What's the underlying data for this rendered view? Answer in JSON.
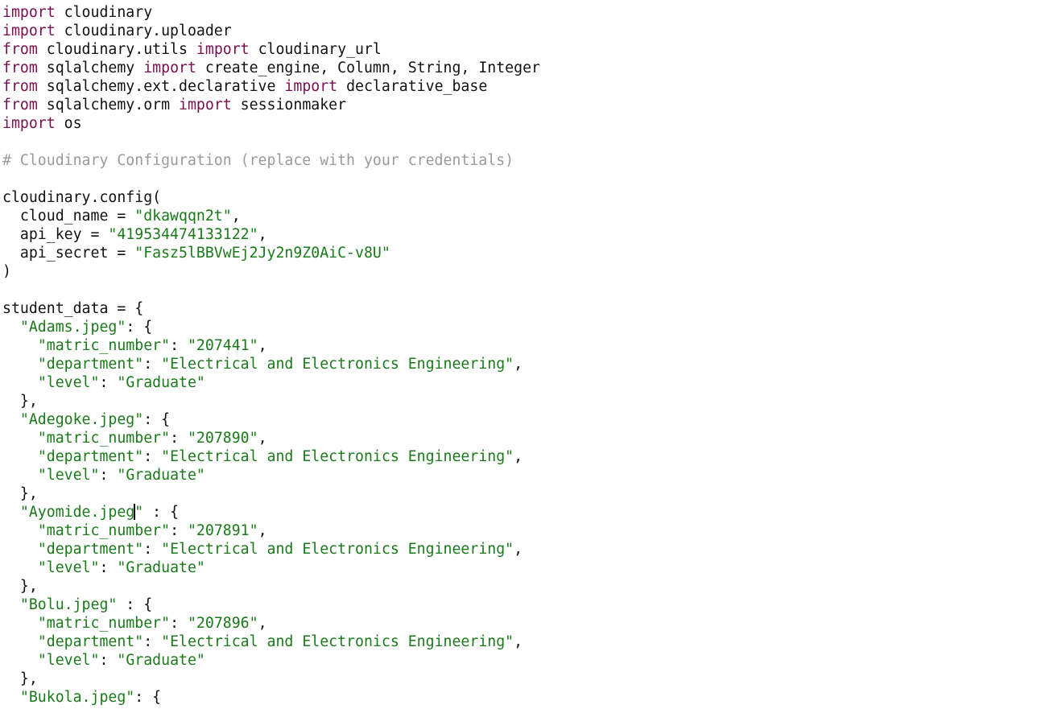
{
  "editor": {
    "cursor_line_index": 27,
    "colors": {
      "keyword": "#7a0f4f",
      "string": "#1a7a1a",
      "comment": "#9a9a9a",
      "text": "#111111",
      "background": "#ffffff"
    },
    "lines": [
      [
        {
          "t": "kw",
          "v": "import"
        },
        {
          "t": "plain",
          "v": " cloudinary"
        }
      ],
      [
        {
          "t": "kw",
          "v": "import"
        },
        {
          "t": "plain",
          "v": " cloudinary.uploader"
        }
      ],
      [
        {
          "t": "kw",
          "v": "from"
        },
        {
          "t": "plain",
          "v": " cloudinary.utils "
        },
        {
          "t": "kw",
          "v": "import"
        },
        {
          "t": "plain",
          "v": " cloudinary_url"
        }
      ],
      [
        {
          "t": "kw",
          "v": "from"
        },
        {
          "t": "plain",
          "v": " sqlalchemy "
        },
        {
          "t": "kw",
          "v": "import"
        },
        {
          "t": "plain",
          "v": " create_engine, Column, String, Integer"
        }
      ],
      [
        {
          "t": "kw",
          "v": "from"
        },
        {
          "t": "plain",
          "v": " sqlalchemy.ext.declarative "
        },
        {
          "t": "kw",
          "v": "import"
        },
        {
          "t": "plain",
          "v": " declarative_base"
        }
      ],
      [
        {
          "t": "kw",
          "v": "from"
        },
        {
          "t": "plain",
          "v": " sqlalchemy.orm "
        },
        {
          "t": "kw",
          "v": "import"
        },
        {
          "t": "plain",
          "v": " sessionmaker"
        }
      ],
      [
        {
          "t": "kw",
          "v": "import"
        },
        {
          "t": "plain",
          "v": " os"
        }
      ],
      [],
      [
        {
          "t": "comment",
          "v": "# Cloudinary Configuration (replace with your credentials)"
        }
      ],
      [],
      [
        {
          "t": "plain",
          "v": "cloudinary.config("
        }
      ],
      [
        {
          "t": "plain",
          "v": "  cloud_name = "
        },
        {
          "t": "str",
          "v": "\"dkawqqn2t\""
        },
        {
          "t": "plain",
          "v": ","
        }
      ],
      [
        {
          "t": "plain",
          "v": "  api_key = "
        },
        {
          "t": "str",
          "v": "\"419534474133122\""
        },
        {
          "t": "plain",
          "v": ","
        }
      ],
      [
        {
          "t": "plain",
          "v": "  api_secret = "
        },
        {
          "t": "str",
          "v": "\"Fasz5lBBVwEj2Jy2n9Z0AiC-v8U\""
        }
      ],
      [
        {
          "t": "plain",
          "v": ")"
        }
      ],
      [],
      [
        {
          "t": "plain",
          "v": "student_data = {"
        }
      ],
      [
        {
          "t": "plain",
          "v": "  "
        },
        {
          "t": "str",
          "v": "\"Adams.jpeg\""
        },
        {
          "t": "plain",
          "v": ": {"
        }
      ],
      [
        {
          "t": "plain",
          "v": "    "
        },
        {
          "t": "str",
          "v": "\"matric_number\""
        },
        {
          "t": "plain",
          "v": ": "
        },
        {
          "t": "str",
          "v": "\"207441\""
        },
        {
          "t": "plain",
          "v": ","
        }
      ],
      [
        {
          "t": "plain",
          "v": "    "
        },
        {
          "t": "str",
          "v": "\"department\""
        },
        {
          "t": "plain",
          "v": ": "
        },
        {
          "t": "str",
          "v": "\"Electrical and Electronics Engineering\""
        },
        {
          "t": "plain",
          "v": ","
        }
      ],
      [
        {
          "t": "plain",
          "v": "    "
        },
        {
          "t": "str",
          "v": "\"level\""
        },
        {
          "t": "plain",
          "v": ": "
        },
        {
          "t": "str",
          "v": "\"Graduate\""
        }
      ],
      [
        {
          "t": "plain",
          "v": "  },"
        }
      ],
      [
        {
          "t": "plain",
          "v": "  "
        },
        {
          "t": "str",
          "v": "\"Adegoke.jpeg\""
        },
        {
          "t": "plain",
          "v": ": {"
        }
      ],
      [
        {
          "t": "plain",
          "v": "    "
        },
        {
          "t": "str",
          "v": "\"matric_number\""
        },
        {
          "t": "plain",
          "v": ": "
        },
        {
          "t": "str",
          "v": "\"207890\""
        },
        {
          "t": "plain",
          "v": ","
        }
      ],
      [
        {
          "t": "plain",
          "v": "    "
        },
        {
          "t": "str",
          "v": "\"department\""
        },
        {
          "t": "plain",
          "v": ": "
        },
        {
          "t": "str",
          "v": "\"Electrical and Electronics Engineering\""
        },
        {
          "t": "plain",
          "v": ","
        }
      ],
      [
        {
          "t": "plain",
          "v": "    "
        },
        {
          "t": "str",
          "v": "\"level\""
        },
        {
          "t": "plain",
          "v": ": "
        },
        {
          "t": "str",
          "v": "\"Graduate\""
        }
      ],
      [
        {
          "t": "plain",
          "v": "  },"
        }
      ],
      [
        {
          "t": "plain",
          "v": "  "
        },
        {
          "t": "str",
          "v": "\"Ayomide.jpeg"
        },
        {
          "t": "caret",
          "v": ""
        },
        {
          "t": "str",
          "v": "\""
        },
        {
          "t": "plain",
          "v": " : {"
        }
      ],
      [
        {
          "t": "plain",
          "v": "    "
        },
        {
          "t": "str",
          "v": "\"matric_number\""
        },
        {
          "t": "plain",
          "v": ": "
        },
        {
          "t": "str",
          "v": "\"207891\""
        },
        {
          "t": "plain",
          "v": ","
        }
      ],
      [
        {
          "t": "plain",
          "v": "    "
        },
        {
          "t": "str",
          "v": "\"department\""
        },
        {
          "t": "plain",
          "v": ": "
        },
        {
          "t": "str",
          "v": "\"Electrical and Electronics Engineering\""
        },
        {
          "t": "plain",
          "v": ","
        }
      ],
      [
        {
          "t": "plain",
          "v": "    "
        },
        {
          "t": "str",
          "v": "\"level\""
        },
        {
          "t": "plain",
          "v": ": "
        },
        {
          "t": "str",
          "v": "\"Graduate\""
        }
      ],
      [
        {
          "t": "plain",
          "v": "  },"
        }
      ],
      [
        {
          "t": "plain",
          "v": "  "
        },
        {
          "t": "str",
          "v": "\"Bolu.jpeg\""
        },
        {
          "t": "plain",
          "v": " : {"
        }
      ],
      [
        {
          "t": "plain",
          "v": "    "
        },
        {
          "t": "str",
          "v": "\"matric_number\""
        },
        {
          "t": "plain",
          "v": ": "
        },
        {
          "t": "str",
          "v": "\"207896\""
        },
        {
          "t": "plain",
          "v": ","
        }
      ],
      [
        {
          "t": "plain",
          "v": "    "
        },
        {
          "t": "str",
          "v": "\"department\""
        },
        {
          "t": "plain",
          "v": ": "
        },
        {
          "t": "str",
          "v": "\"Electrical and Electronics Engineering\""
        },
        {
          "t": "plain",
          "v": ","
        }
      ],
      [
        {
          "t": "plain",
          "v": "    "
        },
        {
          "t": "str",
          "v": "\"level\""
        },
        {
          "t": "plain",
          "v": ": "
        },
        {
          "t": "str",
          "v": "\"Graduate\""
        }
      ],
      [
        {
          "t": "plain",
          "v": "  },"
        }
      ],
      [
        {
          "t": "plain",
          "v": "  "
        },
        {
          "t": "str",
          "v": "\"Bukola.jpeg\""
        },
        {
          "t": "plain",
          "v": ": {"
        }
      ]
    ]
  }
}
